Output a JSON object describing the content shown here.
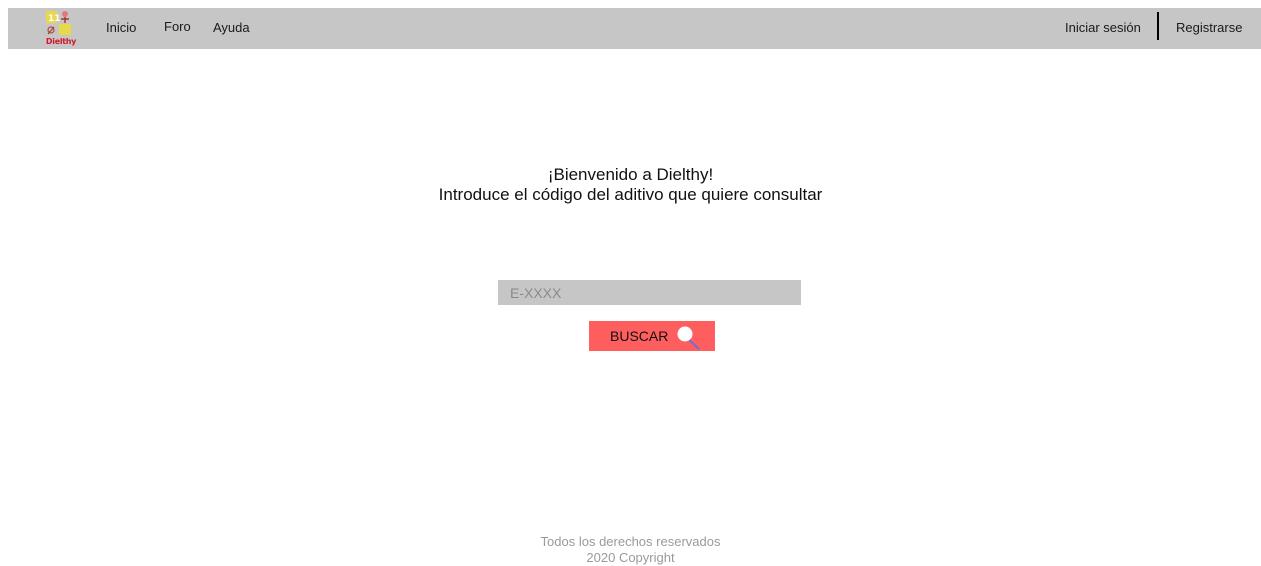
{
  "nav": {
    "logo_text": "Dielthy",
    "links": [
      "Inicio",
      "Foro",
      "Ayuda"
    ],
    "login_label": "Iniciar sesión",
    "register_label": "Registrarse"
  },
  "main": {
    "welcome_line1": "¡Bienvenido a Dielthy!",
    "welcome_line2": "Introduce el código del aditivo que quiere consultar",
    "search": {
      "placeholder": "E-XXXX",
      "value": "",
      "button_label": "BUSCAR"
    }
  },
  "footer": {
    "line1": "Todos los derechos reservados",
    "line2": "2020 Copyright"
  },
  "colors": {
    "navbar_bg": "#c6c6c6",
    "search_button": "#ff5e5e",
    "input_bg": "#c6c6c6",
    "footer_text": "#9a9a9a"
  }
}
